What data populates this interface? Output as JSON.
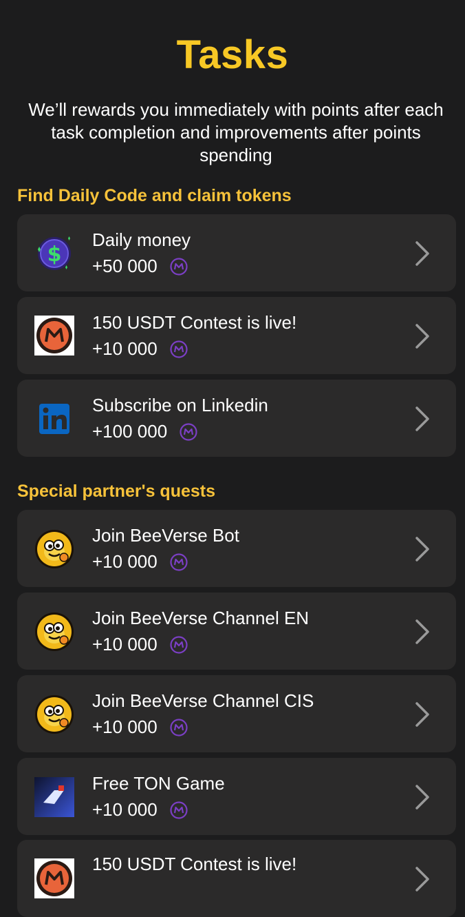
{
  "header": {
    "title": "Tasks",
    "subtitle": "We’ll rewards you immediately with points after each\ntask completion and improvements after points\nspending"
  },
  "sections": [
    {
      "heading": "Find Daily Code and claim tokens",
      "tasks": [
        {
          "title": "Daily money",
          "reward": "+50 000",
          "icon": "dollar-coin-icon"
        },
        {
          "title": "150 USDT Contest is live!",
          "reward": "+10 000",
          "icon": "m-logo-icon"
        },
        {
          "title": "Subscribe on Linkedin",
          "reward": "+100 000",
          "icon": "linkedin-icon"
        }
      ]
    },
    {
      "heading": "Special partner's quests",
      "tasks": [
        {
          "title": "Join BeeVerse Bot",
          "reward": "+10 000",
          "icon": "bee-icon"
        },
        {
          "title": "Join BeeVerse Channel EN",
          "reward": "+10 000",
          "icon": "bee-icon"
        },
        {
          "title": "Join BeeVerse Channel CIS",
          "reward": "+10 000",
          "icon": "bee-icon"
        },
        {
          "title": "Free TON Game",
          "reward": "+10 000",
          "icon": "ton-game-icon"
        },
        {
          "title": "150 USDT Contest is live!",
          "reward": "",
          "icon": "m-logo-icon"
        }
      ]
    }
  ],
  "colors": {
    "background": "#1c1c1d",
    "card": "#2b2a2a",
    "accent": "#f7c825",
    "coin": "#7b3fc4"
  }
}
